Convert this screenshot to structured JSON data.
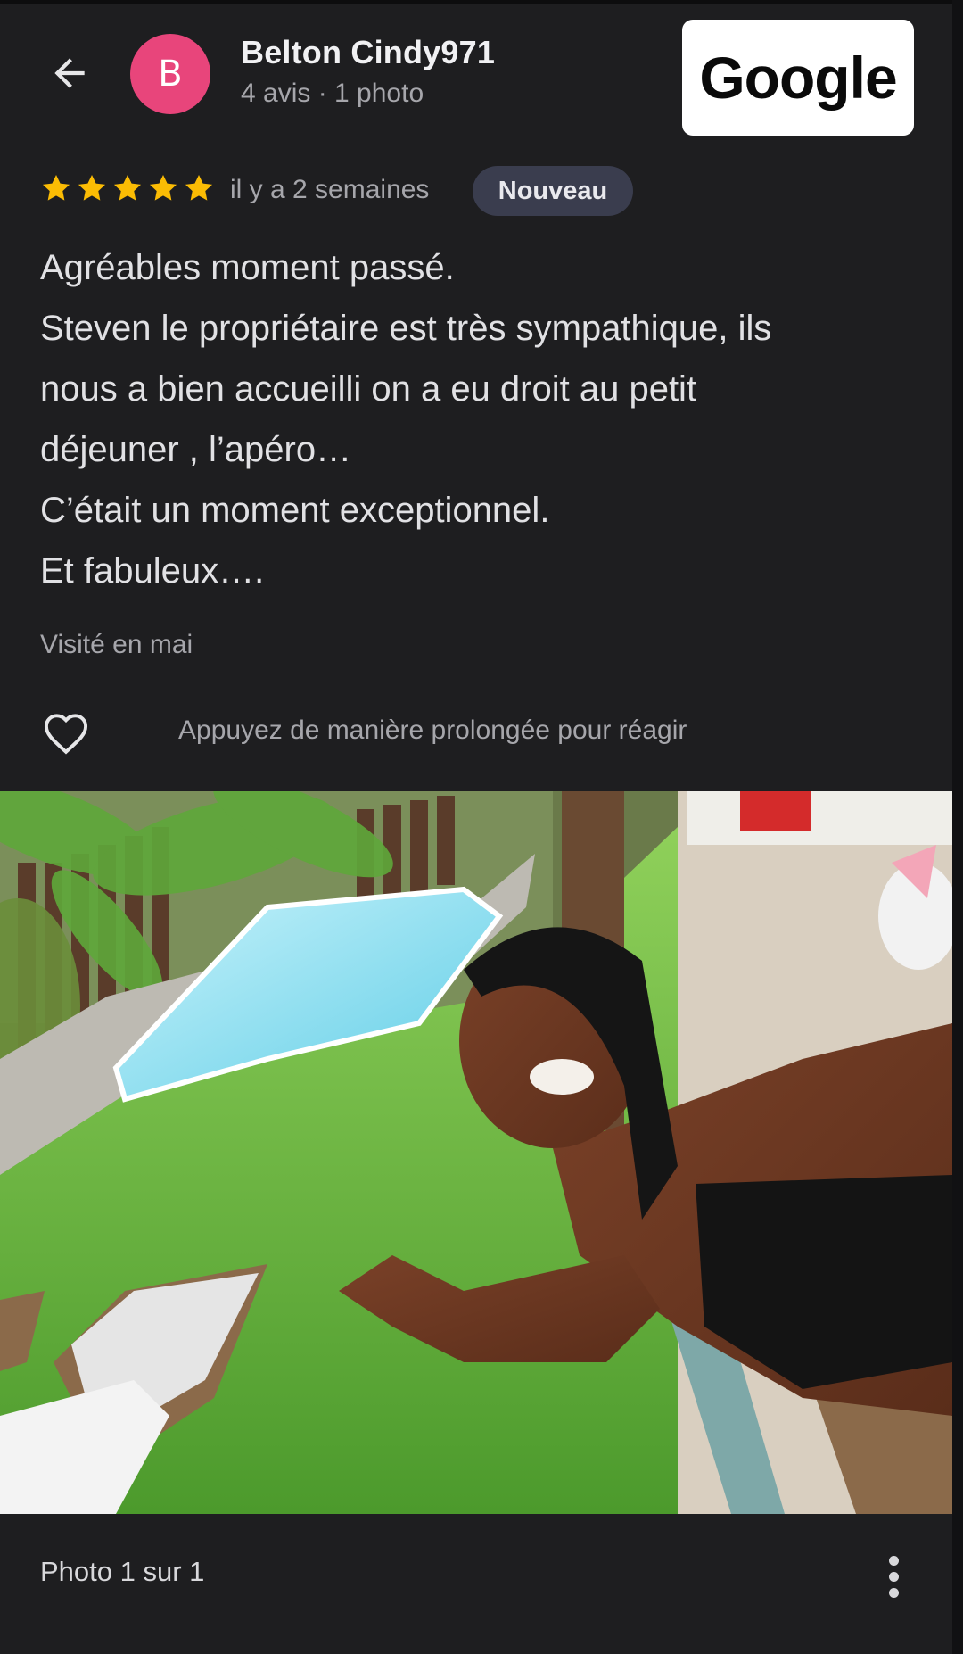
{
  "header": {
    "back_icon": "arrow-left-icon",
    "avatar_letter": "B",
    "avatar_color": "#e8457b",
    "user_name": "Belton Cindy971",
    "user_meta": "4 avis · 1 photo",
    "google_label": "Google"
  },
  "rating": {
    "stars": 5,
    "max_stars": 5,
    "star_color": "#fbbc04",
    "time_ago": "il y a 2 semaines",
    "badge": "Nouveau"
  },
  "review": {
    "lines": [
      "Agréables moment passé.",
      "Steven le propriétaire est très sympathique, ils",
      "nous a bien accueilli on a eu droit au petit",
      "déjeuner , l’apéro…",
      "C’était un moment exceptionnel.",
      "Et fabuleux…."
    ],
    "visited": "Visité en mai"
  },
  "reaction": {
    "icon": "heart-outline-icon",
    "hint": "Appuyez de manière prolongée pour réagir"
  },
  "photo": {
    "kind": "review-photo"
  },
  "footer": {
    "counter": "Photo 1 sur 1",
    "more_icon": "more-vertical-icon"
  }
}
